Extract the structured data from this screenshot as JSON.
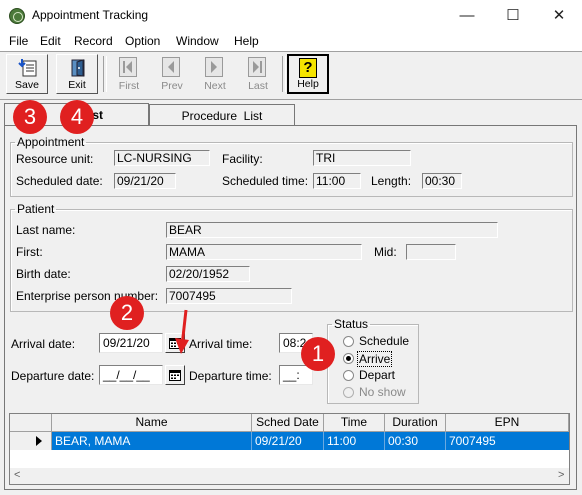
{
  "window": {
    "title": "Appointment Tracking",
    "minimize": "—",
    "maximize": "☐",
    "close": "✕"
  },
  "menu": [
    "File",
    "Edit",
    "Record",
    "Option",
    "Window",
    "Help"
  ],
  "toolbar": {
    "save": "Save",
    "exit": "Exit",
    "first": "First",
    "prev": "Prev",
    "next": "Next",
    "last": "Last",
    "help": "Help"
  },
  "tabs": {
    "active_partial": "ist",
    "procedure": "Procedure  List"
  },
  "appointment": {
    "legend": "Appointment",
    "resource_unit_label": "Resource unit:",
    "resource_unit": "LC-NURSING",
    "facility_label": "Facility:",
    "facility": "TRI",
    "scheduled_date_label": "Scheduled date:",
    "scheduled_date": "09/21/20",
    "scheduled_time_label": "Scheduled time:",
    "scheduled_time": "11:00",
    "length_label": "Length:",
    "length": "00:30"
  },
  "patient": {
    "legend": "Patient",
    "last_name_label": "Last name:",
    "last_name": "BEAR",
    "first_label": "First:",
    "first": "MAMA",
    "mid_label": "Mid:",
    "mid": "",
    "birth_date_label": "Birth date:",
    "birth_date": "02/20/1952",
    "epn_label": "Enterprise person number:",
    "epn": "7007495"
  },
  "arrival": {
    "arrival_date_label": "Arrival date:",
    "arrival_date": "09/21/20",
    "arrival_time_label": "Arrival time:",
    "arrival_time": "08:2",
    "departure_date_label": "Departure date:",
    "departure_date": "__/__/__",
    "departure_time_label": "Departure time:",
    "departure_time": "__:"
  },
  "status": {
    "legend": "Status",
    "options": [
      {
        "label": "Schedule",
        "checked": false,
        "enabled": true
      },
      {
        "label": "Arrive",
        "checked": true,
        "enabled": true
      },
      {
        "label": "Depart",
        "checked": false,
        "enabled": true
      },
      {
        "label": "No show",
        "checked": false,
        "enabled": false
      }
    ]
  },
  "grid": {
    "columns": [
      "Name",
      "Sched Date",
      "Time",
      "Duration",
      "EPN"
    ],
    "rows": [
      {
        "name": "BEAR, MAMA",
        "sched_date": "09/21/20",
        "time": "11:00",
        "duration": "00:30",
        "epn": "7007495"
      }
    ]
  },
  "annotations": [
    "1",
    "2",
    "3",
    "4"
  ],
  "colors": {
    "selection": "#0078d7",
    "badge": "#e02020",
    "help_icon": "#f5e400"
  }
}
